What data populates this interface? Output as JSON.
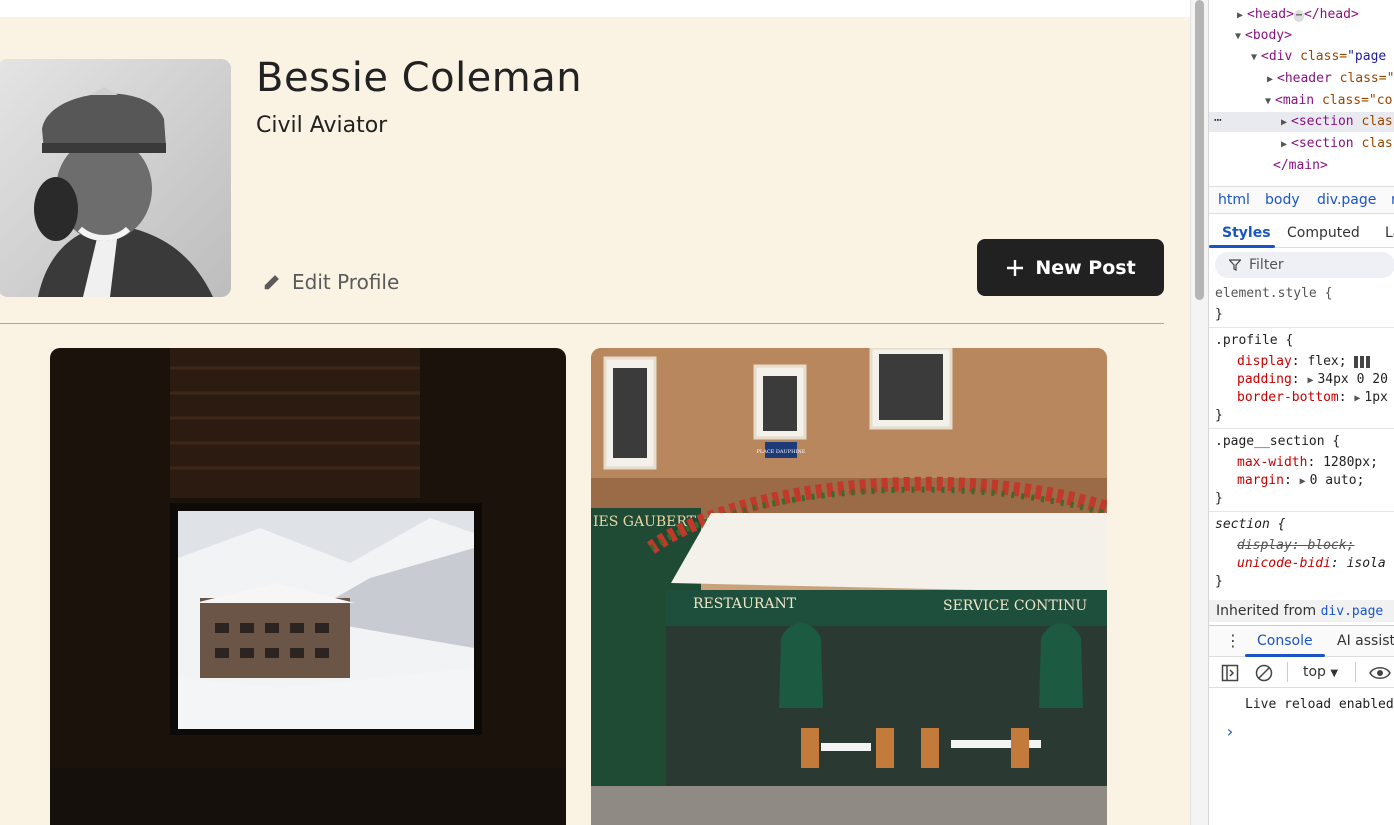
{
  "profile": {
    "name": "Bessie Coleman",
    "occupation": "Civil Aviator",
    "edit_label": "Edit Profile",
    "new_post_label": "New Post"
  },
  "cards": [
    {
      "icon": "ski-resort-window-photo"
    },
    {
      "icon": "paris-restaurant-photo",
      "sign_left": "RESTAURANT",
      "sign_right": "SERVICE CONTINU",
      "shop_name": "IES GAUBERT",
      "street_sign": "PLACE DAUPHINE"
    }
  ],
  "devtools": {
    "dom": {
      "head_open": "<head>",
      "head_close": "</head>",
      "body": "<body>",
      "div_open": "<div",
      "div_attr": "class=",
      "div_val": "\"page",
      "header_open": "<header",
      "header_attr": "class=\"",
      "main_open": "<main",
      "main_attr": "class=\"co",
      "section1": "<section",
      "section1_attr": "clas",
      "section2": "<section",
      "section2_attr": "clas",
      "main_close": "</main>"
    },
    "breadcrumbs": [
      "html",
      "body",
      "div.page",
      "m"
    ],
    "tabs": [
      "Styles",
      "Computed",
      "La"
    ],
    "filter_placeholder": "Filter",
    "styles": {
      "element_style": "element.style {",
      "close": "}",
      "profile_selector": ".profile {",
      "p1_prop": "display",
      "p1_val": "flex;",
      "p2_prop": "padding",
      "p2_val": "34px 0 20",
      "p3_prop": "border-bottom",
      "p3_val": "1px",
      "section_selector": ".page__section {",
      "s1_prop": "max-width",
      "s1_val": "1280px;",
      "s2_prop": "margin",
      "s2_val": "0 auto;",
      "ua_selector": "section {",
      "u1": "display: block;",
      "u2_prop": "unicode-bidi",
      "u2_val": "isola"
    },
    "inherited_label": "Inherited from",
    "inherited_link": "div.page",
    "drawer_tabs": [
      "Console",
      "AI assista"
    ],
    "console_context": "top",
    "console_message": "Live reload enabled",
    "accent": "#1a55c6"
  }
}
